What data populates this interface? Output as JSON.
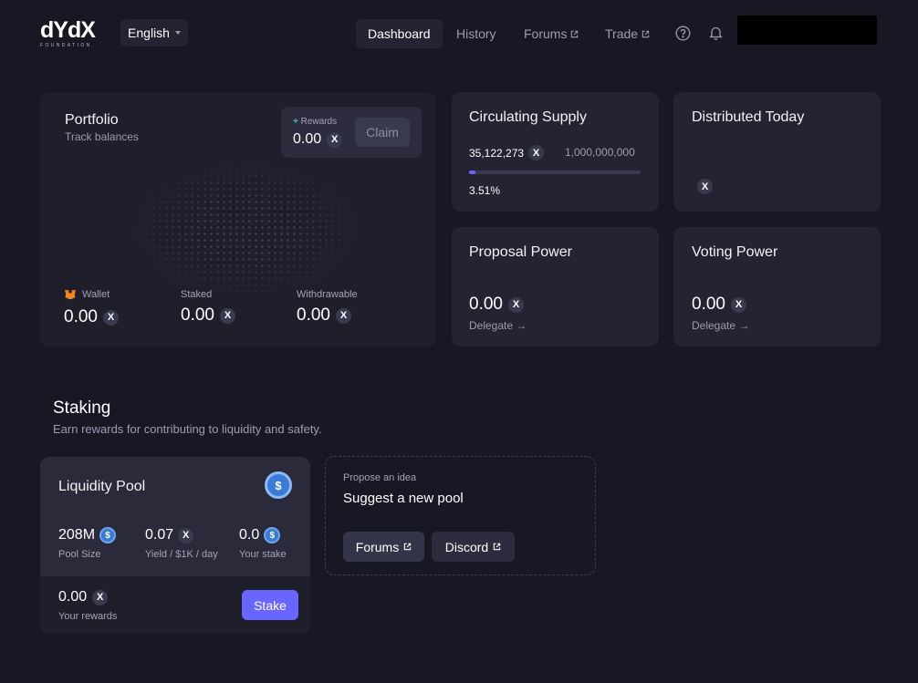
{
  "header": {
    "logo_main": "dYdX",
    "logo_sub": "FOUNDATION",
    "language": "English",
    "nav": {
      "dashboard": "Dashboard",
      "history": "History",
      "forums": "Forums",
      "trade": "Trade"
    },
    "icons": {
      "help": "help-icon",
      "notifications": "bell-icon"
    }
  },
  "portfolio": {
    "title": "Portfolio",
    "subtitle": "Track balances",
    "rewards_label": "Rewards",
    "rewards_value": "0.00",
    "claim_label": "Claim",
    "wallet_label": "Wallet",
    "wallet_value": "0.00",
    "staked_label": "Staked",
    "staked_value": "0.00",
    "withdrawable_label": "Withdrawable",
    "withdrawable_value": "0.00"
  },
  "circulating_supply": {
    "title": "Circulating Supply",
    "value": "35,122,273",
    "total": "1,000,000,000",
    "percent_label": "3.51%",
    "progress_fraction": 0.0351
  },
  "distributed_today": {
    "title": "Distributed Today"
  },
  "proposal_power": {
    "title": "Proposal Power",
    "value": "0.00",
    "link": "Delegate →"
  },
  "voting_power": {
    "title": "Voting Power",
    "value": "0.00",
    "link": "Delegate →"
  },
  "staking": {
    "title": "Staking",
    "subtitle": "Earn rewards for contributing to liquidity and safety.",
    "pool": {
      "title": "Liquidity Pool",
      "pool_size_value": "208M",
      "pool_size_label": "Pool Size",
      "yield_value": "0.07",
      "yield_label": "Yield / $1K / day",
      "your_stake_value": "0.0",
      "your_stake_label": "Your stake",
      "rewards_value": "0.00",
      "rewards_label": "Your rewards",
      "stake_button": "Stake"
    },
    "suggest": {
      "kicker": "Propose an idea",
      "title": "Suggest a new pool",
      "forums_button": "Forums",
      "discord_button": "Discord"
    }
  },
  "colors": {
    "background": "#181825",
    "card": "#232332",
    "accent": "#6966ff",
    "usdc": "#3a7bd5",
    "rewards_plus": "#3cc497"
  }
}
